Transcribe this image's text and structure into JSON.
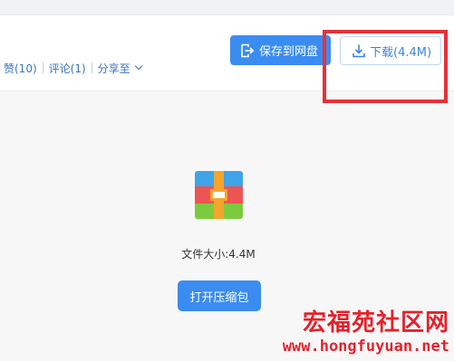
{
  "header": {
    "actions": {
      "like_label": "赞(10)",
      "comment_label": "评论(1)",
      "share_label": "分享至"
    },
    "save_button": {
      "label": "保存到网盘",
      "icon": "save-to-cloud-icon"
    },
    "download_button": {
      "label": "下载(4.4M)",
      "icon": "download-icon"
    },
    "highlight_color": "#e5323a",
    "accent_color": "#3b8cf0"
  },
  "preview": {
    "icon": "archive-file-icon",
    "file_size_text": "文件大小:4.4M",
    "open_button_label": "打开压缩包"
  },
  "watermark": {
    "site_name": "宏福苑社区网",
    "url": "www.hongfuyuan.net",
    "color": "#e3222c"
  }
}
